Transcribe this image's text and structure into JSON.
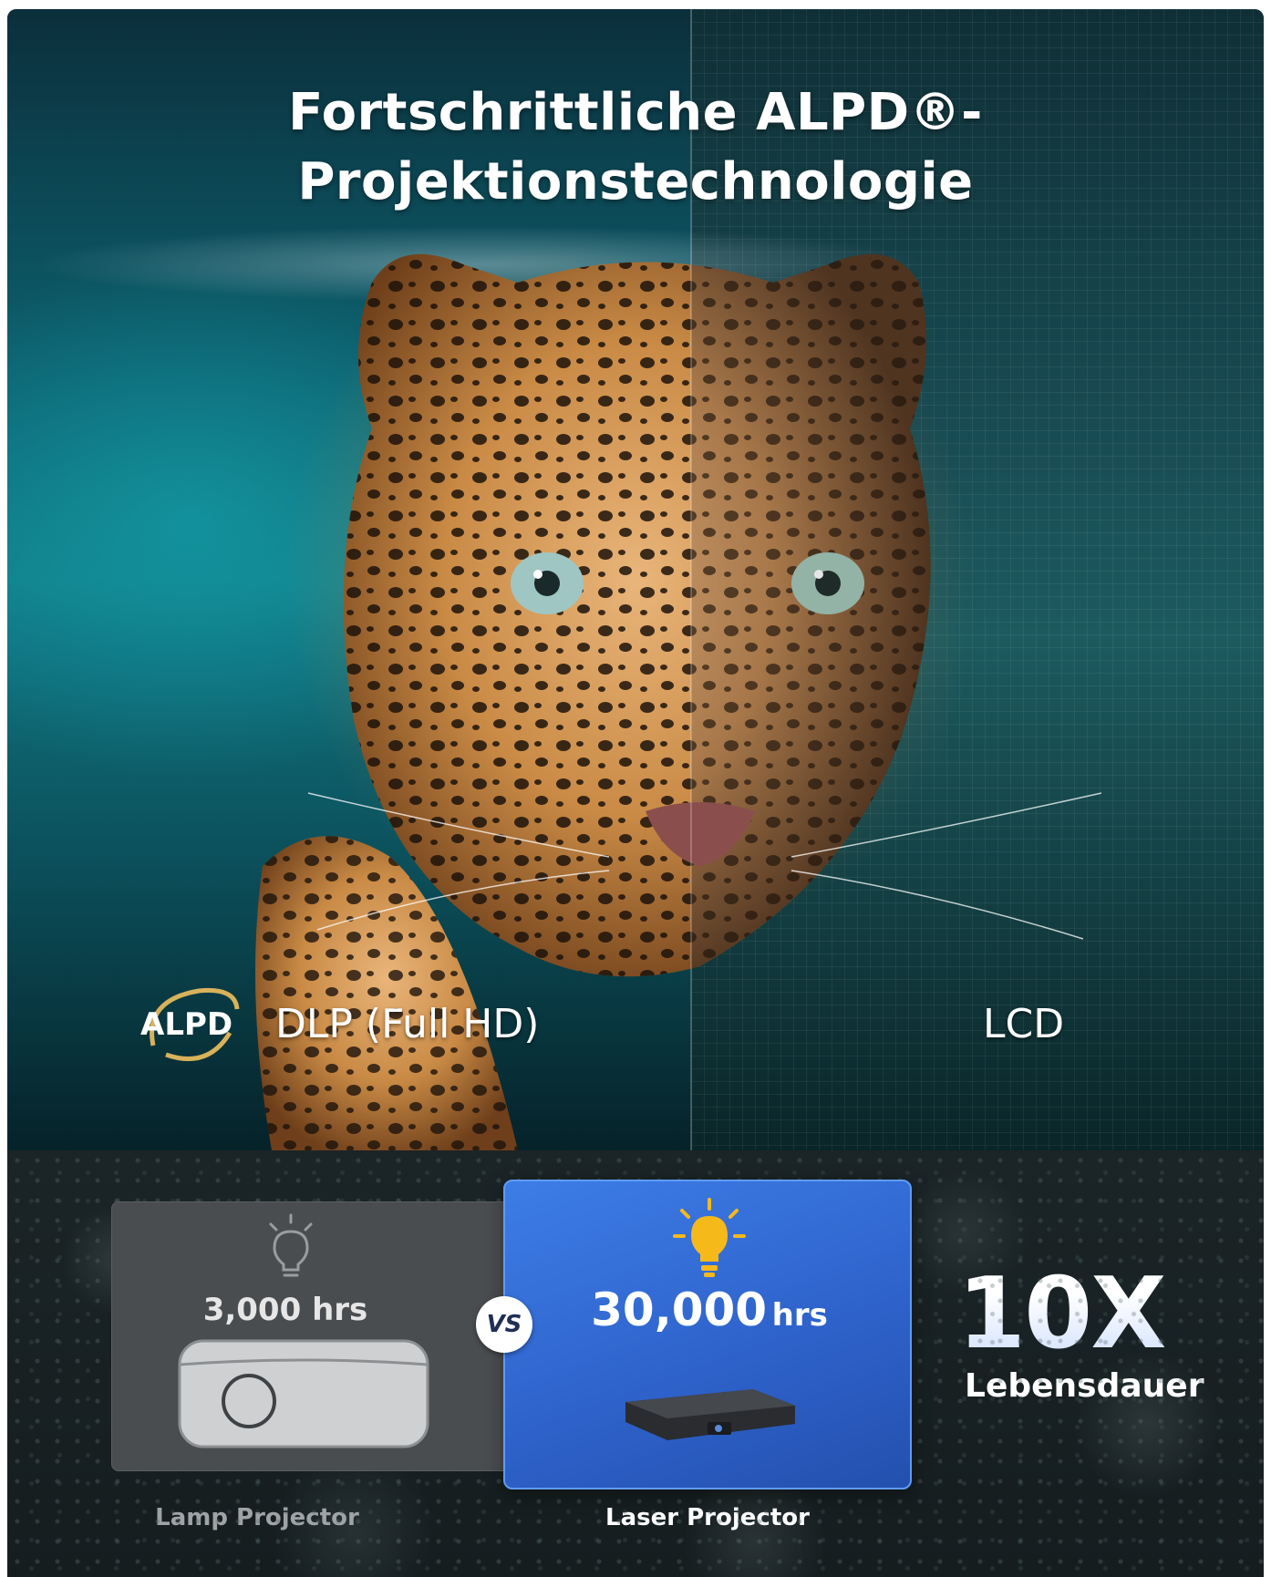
{
  "hero": {
    "title_line1": "Fortschrittliche ALPD®-",
    "title_line2": "Projektionstechnologie",
    "logo_text": "ALPD",
    "left_label": "DLP  (Full HD)",
    "right_label": "LCD"
  },
  "comparison": {
    "lamp": {
      "hours": "3,000 hrs",
      "caption": "Lamp Projector",
      "icon": "lightbulb-outline-icon"
    },
    "vs": "VS",
    "laser": {
      "hours_value": "30,000",
      "hours_unit": "hrs",
      "caption": "Laser Projector",
      "icon": "lightbulb-glowing-icon"
    },
    "multiplier": "10X",
    "multiplier_label": "Lebensdauer"
  },
  "colors": {
    "laser_card": "#3d7de6",
    "lamp_card": "#4a4d50",
    "bulb_glow": "#f6b91a",
    "alpd_gold": "#d8b25a"
  }
}
